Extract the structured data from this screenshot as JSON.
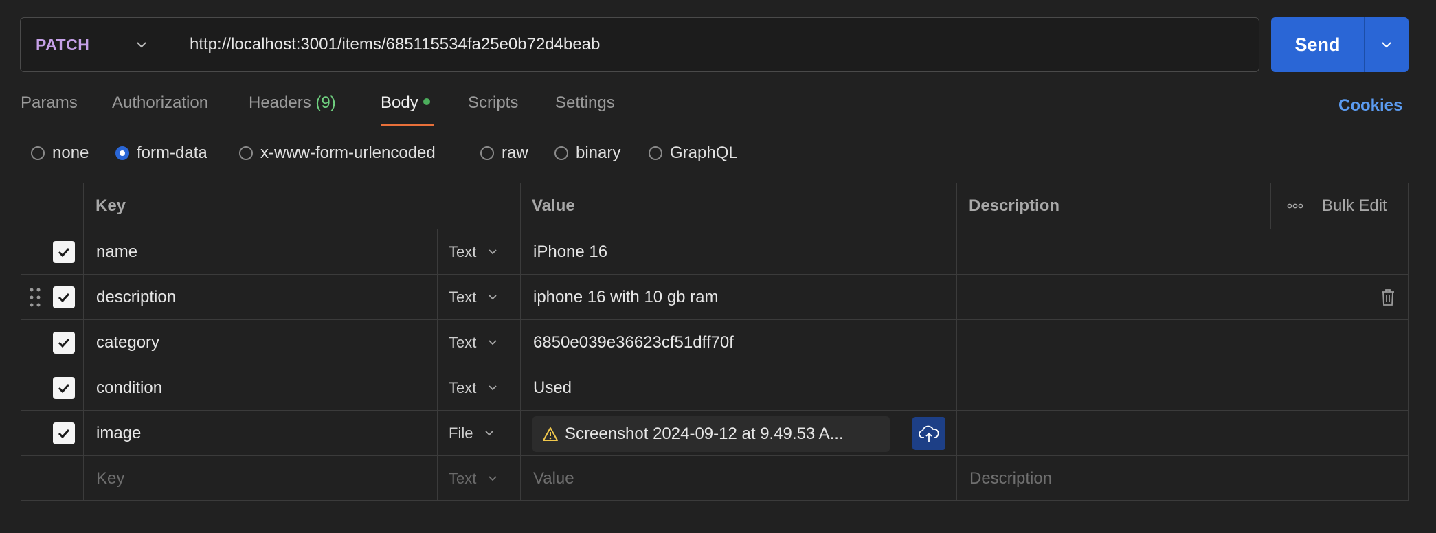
{
  "request": {
    "method": "PATCH",
    "url": "http://localhost:3001/items/685115534fa25e0b72d4beab",
    "send_label": "Send"
  },
  "tabs": {
    "params": "Params",
    "authorization": "Authorization",
    "headers": "Headers",
    "headers_count": "(9)",
    "body": "Body",
    "scripts": "Scripts",
    "settings": "Settings",
    "cookies": "Cookies"
  },
  "body_modes": {
    "selected": "form-data",
    "options": [
      "none",
      "form-data",
      "x-www-form-urlencoded",
      "raw",
      "binary",
      "GraphQL"
    ]
  },
  "table": {
    "headers": {
      "key": "Key",
      "value": "Value",
      "description": "Description",
      "bulk_edit": "Bulk Edit"
    },
    "rows": [
      {
        "key": "name",
        "type": "Text",
        "value": "iPhone 16",
        "checked": true
      },
      {
        "key": "description",
        "type": "Text",
        "value": "iphone 16 with 10 gb ram",
        "checked": true
      },
      {
        "key": "category",
        "type": "Text",
        "value": "6850e039e36623cf51dff70f",
        "checked": true
      },
      {
        "key": "condition",
        "type": "Text",
        "value": "Used",
        "checked": true
      },
      {
        "key": "image",
        "type": "File",
        "value": "Screenshot 2024-09-12 at 9.49.53 A...",
        "checked": true
      }
    ],
    "placeholders": {
      "key": "Key",
      "type": "Text",
      "value": "Value",
      "description": "Description"
    }
  },
  "colors": {
    "background": "#212121",
    "accent": "#2a66d6",
    "method": "#c6a0e8",
    "tab_underline": "#e8703a",
    "body_dot": "#4cae5c",
    "cookies_link": "#5b9bf0"
  }
}
